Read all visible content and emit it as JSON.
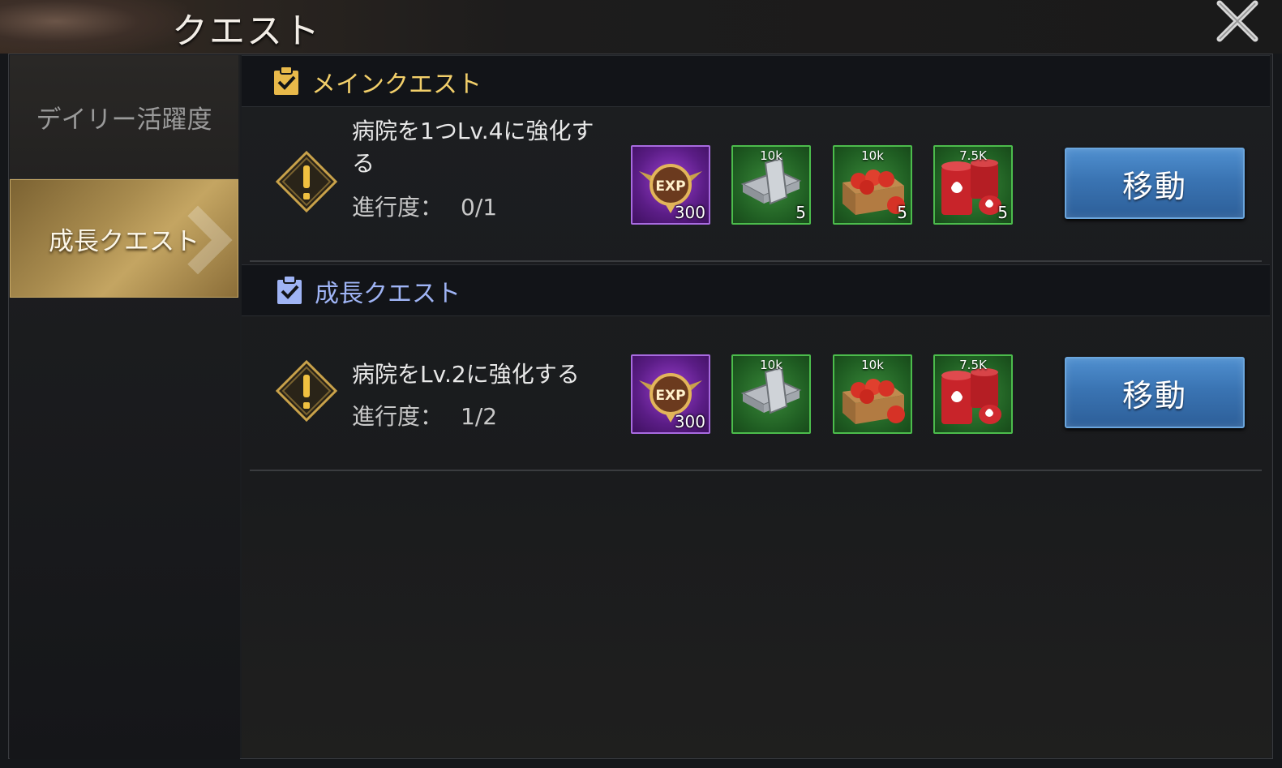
{
  "header": {
    "title": "クエスト"
  },
  "sidebar": {
    "tabs": [
      {
        "label": "デイリー活躍度",
        "active": false
      },
      {
        "label": "成長クエスト",
        "active": true
      }
    ]
  },
  "sections": [
    {
      "title": "メインクエスト",
      "title_color": "#f2cf6a",
      "icon_color": "#e8b94a",
      "quest": {
        "text_line1": "病院を1つLv.4に強化す",
        "text_line2": "る",
        "progress_label": "進行度：",
        "progress_value": "0/1",
        "rewards": [
          {
            "kind": "exp",
            "icon": "exp-badge-icon",
            "badge": "EXP",
            "top": "",
            "qty": "300"
          },
          {
            "kind": "steel",
            "icon": "steel-beam-icon",
            "top": "10k",
            "qty": "5"
          },
          {
            "kind": "food",
            "icon": "tomato-crate-icon",
            "top": "10k",
            "qty": "5"
          },
          {
            "kind": "oil",
            "icon": "oil-barrel-icon",
            "top": "7.5K",
            "qty": "5"
          }
        ],
        "button_label": "移動"
      }
    },
    {
      "title": "成長クエスト",
      "title_color": "#9fb4f5",
      "icon_color": "#9fb4f5",
      "quest": {
        "text_line1": "病院をLv.2に強化する",
        "text_line2": "",
        "progress_label": "進行度：",
        "progress_value": "1/2",
        "rewards": [
          {
            "kind": "exp",
            "icon": "exp-badge-icon",
            "badge": "EXP",
            "top": "",
            "qty": "300"
          },
          {
            "kind": "steel",
            "icon": "steel-beam-icon",
            "top": "10k",
            "qty": ""
          },
          {
            "kind": "food",
            "icon": "tomato-crate-icon",
            "top": "10k",
            "qty": ""
          },
          {
            "kind": "oil",
            "icon": "oil-barrel-icon",
            "top": "7.5K",
            "qty": ""
          }
        ],
        "button_label": "移動"
      }
    }
  ]
}
